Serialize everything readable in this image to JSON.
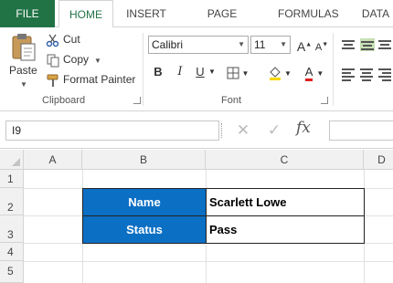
{
  "ribbon": {
    "tabs": [
      "FILE",
      "HOME",
      "INSERT",
      "PAGE LAYOUT",
      "FORMULAS",
      "DATA"
    ],
    "active_tab": "HOME",
    "clipboard": {
      "paste_label": "Paste",
      "cut_label": "Cut",
      "copy_label": "Copy",
      "format_painter_label": "Format Painter",
      "group_label": "Clipboard"
    },
    "font": {
      "font_name": "Calibri",
      "font_size": "11",
      "bold": "B",
      "italic": "I",
      "underline": "U",
      "font_color_glyph": "A",
      "group_label": "Font"
    }
  },
  "formula_bar": {
    "name_box": "I9",
    "cancel_glyph": "✕",
    "enter_glyph": "✓",
    "fx_glyph": "fx",
    "content": ""
  },
  "sheet": {
    "columns": [
      "A",
      "B",
      "C",
      "D"
    ],
    "rows": [
      "1",
      "2",
      "3",
      "4",
      "5"
    ],
    "cells": {
      "B2": "Name",
      "C2": "Scarlett Lowe",
      "B3": "Status",
      "C3": "Pass"
    }
  },
  "colors": {
    "file_tab": "#217346",
    "label_fill": "#0b6fc4",
    "label_text": "#ffffff"
  }
}
